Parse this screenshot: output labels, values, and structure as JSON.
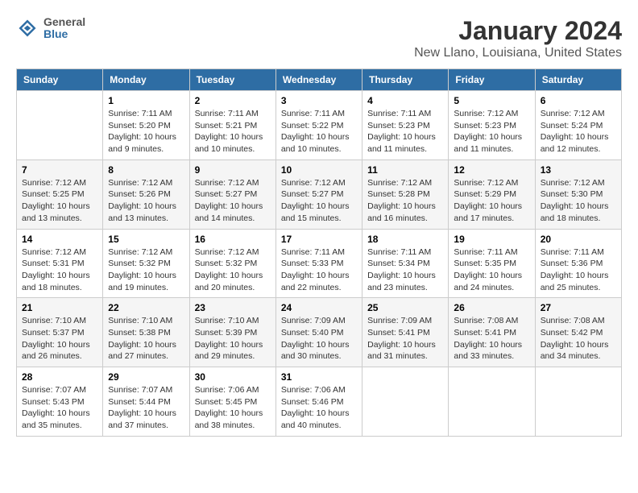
{
  "header": {
    "logo_line1": "General",
    "logo_line2": "Blue",
    "title": "January 2024",
    "subtitle": "New Llano, Louisiana, United States"
  },
  "calendar": {
    "days_of_week": [
      "Sunday",
      "Monday",
      "Tuesday",
      "Wednesday",
      "Thursday",
      "Friday",
      "Saturday"
    ],
    "weeks": [
      [
        {
          "day": "",
          "info": ""
        },
        {
          "day": "1",
          "info": "Sunrise: 7:11 AM\nSunset: 5:20 PM\nDaylight: 10 hours\nand 9 minutes."
        },
        {
          "day": "2",
          "info": "Sunrise: 7:11 AM\nSunset: 5:21 PM\nDaylight: 10 hours\nand 10 minutes."
        },
        {
          "day": "3",
          "info": "Sunrise: 7:11 AM\nSunset: 5:22 PM\nDaylight: 10 hours\nand 10 minutes."
        },
        {
          "day": "4",
          "info": "Sunrise: 7:11 AM\nSunset: 5:23 PM\nDaylight: 10 hours\nand 11 minutes."
        },
        {
          "day": "5",
          "info": "Sunrise: 7:12 AM\nSunset: 5:23 PM\nDaylight: 10 hours\nand 11 minutes."
        },
        {
          "day": "6",
          "info": "Sunrise: 7:12 AM\nSunset: 5:24 PM\nDaylight: 10 hours\nand 12 minutes."
        }
      ],
      [
        {
          "day": "7",
          "info": "Sunrise: 7:12 AM\nSunset: 5:25 PM\nDaylight: 10 hours\nand 13 minutes."
        },
        {
          "day": "8",
          "info": "Sunrise: 7:12 AM\nSunset: 5:26 PM\nDaylight: 10 hours\nand 13 minutes."
        },
        {
          "day": "9",
          "info": "Sunrise: 7:12 AM\nSunset: 5:27 PM\nDaylight: 10 hours\nand 14 minutes."
        },
        {
          "day": "10",
          "info": "Sunrise: 7:12 AM\nSunset: 5:27 PM\nDaylight: 10 hours\nand 15 minutes."
        },
        {
          "day": "11",
          "info": "Sunrise: 7:12 AM\nSunset: 5:28 PM\nDaylight: 10 hours\nand 16 minutes."
        },
        {
          "day": "12",
          "info": "Sunrise: 7:12 AM\nSunset: 5:29 PM\nDaylight: 10 hours\nand 17 minutes."
        },
        {
          "day": "13",
          "info": "Sunrise: 7:12 AM\nSunset: 5:30 PM\nDaylight: 10 hours\nand 18 minutes."
        }
      ],
      [
        {
          "day": "14",
          "info": "Sunrise: 7:12 AM\nSunset: 5:31 PM\nDaylight: 10 hours\nand 18 minutes."
        },
        {
          "day": "15",
          "info": "Sunrise: 7:12 AM\nSunset: 5:32 PM\nDaylight: 10 hours\nand 19 minutes."
        },
        {
          "day": "16",
          "info": "Sunrise: 7:12 AM\nSunset: 5:32 PM\nDaylight: 10 hours\nand 20 minutes."
        },
        {
          "day": "17",
          "info": "Sunrise: 7:11 AM\nSunset: 5:33 PM\nDaylight: 10 hours\nand 22 minutes."
        },
        {
          "day": "18",
          "info": "Sunrise: 7:11 AM\nSunset: 5:34 PM\nDaylight: 10 hours\nand 23 minutes."
        },
        {
          "day": "19",
          "info": "Sunrise: 7:11 AM\nSunset: 5:35 PM\nDaylight: 10 hours\nand 24 minutes."
        },
        {
          "day": "20",
          "info": "Sunrise: 7:11 AM\nSunset: 5:36 PM\nDaylight: 10 hours\nand 25 minutes."
        }
      ],
      [
        {
          "day": "21",
          "info": "Sunrise: 7:10 AM\nSunset: 5:37 PM\nDaylight: 10 hours\nand 26 minutes."
        },
        {
          "day": "22",
          "info": "Sunrise: 7:10 AM\nSunset: 5:38 PM\nDaylight: 10 hours\nand 27 minutes."
        },
        {
          "day": "23",
          "info": "Sunrise: 7:10 AM\nSunset: 5:39 PM\nDaylight: 10 hours\nand 29 minutes."
        },
        {
          "day": "24",
          "info": "Sunrise: 7:09 AM\nSunset: 5:40 PM\nDaylight: 10 hours\nand 30 minutes."
        },
        {
          "day": "25",
          "info": "Sunrise: 7:09 AM\nSunset: 5:41 PM\nDaylight: 10 hours\nand 31 minutes."
        },
        {
          "day": "26",
          "info": "Sunrise: 7:08 AM\nSunset: 5:41 PM\nDaylight: 10 hours\nand 33 minutes."
        },
        {
          "day": "27",
          "info": "Sunrise: 7:08 AM\nSunset: 5:42 PM\nDaylight: 10 hours\nand 34 minutes."
        }
      ],
      [
        {
          "day": "28",
          "info": "Sunrise: 7:07 AM\nSunset: 5:43 PM\nDaylight: 10 hours\nand 35 minutes."
        },
        {
          "day": "29",
          "info": "Sunrise: 7:07 AM\nSunset: 5:44 PM\nDaylight: 10 hours\nand 37 minutes."
        },
        {
          "day": "30",
          "info": "Sunrise: 7:06 AM\nSunset: 5:45 PM\nDaylight: 10 hours\nand 38 minutes."
        },
        {
          "day": "31",
          "info": "Sunrise: 7:06 AM\nSunset: 5:46 PM\nDaylight: 10 hours\nand 40 minutes."
        },
        {
          "day": "",
          "info": ""
        },
        {
          "day": "",
          "info": ""
        },
        {
          "day": "",
          "info": ""
        }
      ]
    ]
  }
}
